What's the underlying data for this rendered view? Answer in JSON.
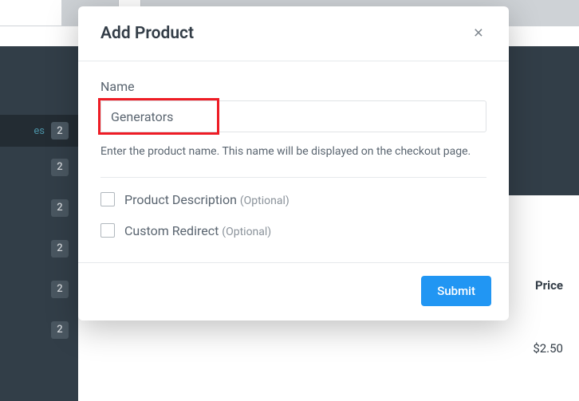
{
  "background": {
    "sidebar": {
      "row0_text": "es",
      "badges": [
        "2",
        "2",
        "2",
        "2",
        "2",
        "2"
      ]
    },
    "table": {
      "price_header": "Price",
      "price_value": "$2.50"
    }
  },
  "modal": {
    "title": "Add Product",
    "close_symbol": "×",
    "name": {
      "label": "Name",
      "value": "Generators",
      "help": "Enter the product name. This name will be displayed on the checkout page."
    },
    "options": {
      "product_description": {
        "label": "Product Description",
        "suffix": "(Optional)"
      },
      "custom_redirect": {
        "label": "Custom Redirect",
        "suffix": "(Optional)"
      }
    },
    "submit_label": "Submit"
  }
}
